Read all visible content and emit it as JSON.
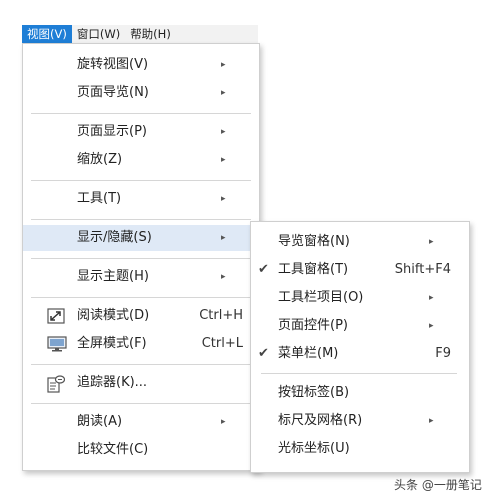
{
  "menubar": [
    {
      "label": "视图(V)"
    },
    {
      "label": "窗口(W)"
    },
    {
      "label": "帮助(H)"
    }
  ],
  "view_menu": {
    "items": [
      {
        "label": "旋转视图(V)"
      },
      {
        "label": "页面导览(N)"
      },
      {
        "label": "页面显示(P)"
      },
      {
        "label": "缩放(Z)"
      },
      {
        "label": "工具(T)"
      },
      {
        "label": "显示/隐藏(S)"
      },
      {
        "label": "显示主题(H)"
      },
      {
        "label": "阅读模式(D)",
        "shortcut": "Ctrl+H",
        "icon": "read-mode-icon"
      },
      {
        "label": "全屏模式(F)",
        "shortcut": "Ctrl+L",
        "icon": "fullscreen-icon"
      },
      {
        "label": "追踪器(K)...",
        "icon": "tracker-icon"
      },
      {
        "label": "朗读(A)"
      },
      {
        "label": "比较文件(C)"
      }
    ]
  },
  "show_hide_submenu": {
    "items": [
      {
        "label": "导览窗格(N)"
      },
      {
        "label": "工具窗格(T)",
        "shortcut": "Shift+F4",
        "checked": true
      },
      {
        "label": "工具栏项目(O)"
      },
      {
        "label": "页面控件(P)"
      },
      {
        "label": "菜单栏(M)",
        "shortcut": "F9",
        "checked": true
      },
      {
        "label": "按钮标签(B)"
      },
      {
        "label": "标尺及网格(R)"
      },
      {
        "label": "光标坐标(U)"
      }
    ]
  },
  "symbols": {
    "arrow": "▸",
    "check": "✔"
  },
  "colors": {
    "menubar_active": "#1e7ed6",
    "highlight": "#dfe9f6"
  },
  "watermark": "头条 @一册笔记"
}
